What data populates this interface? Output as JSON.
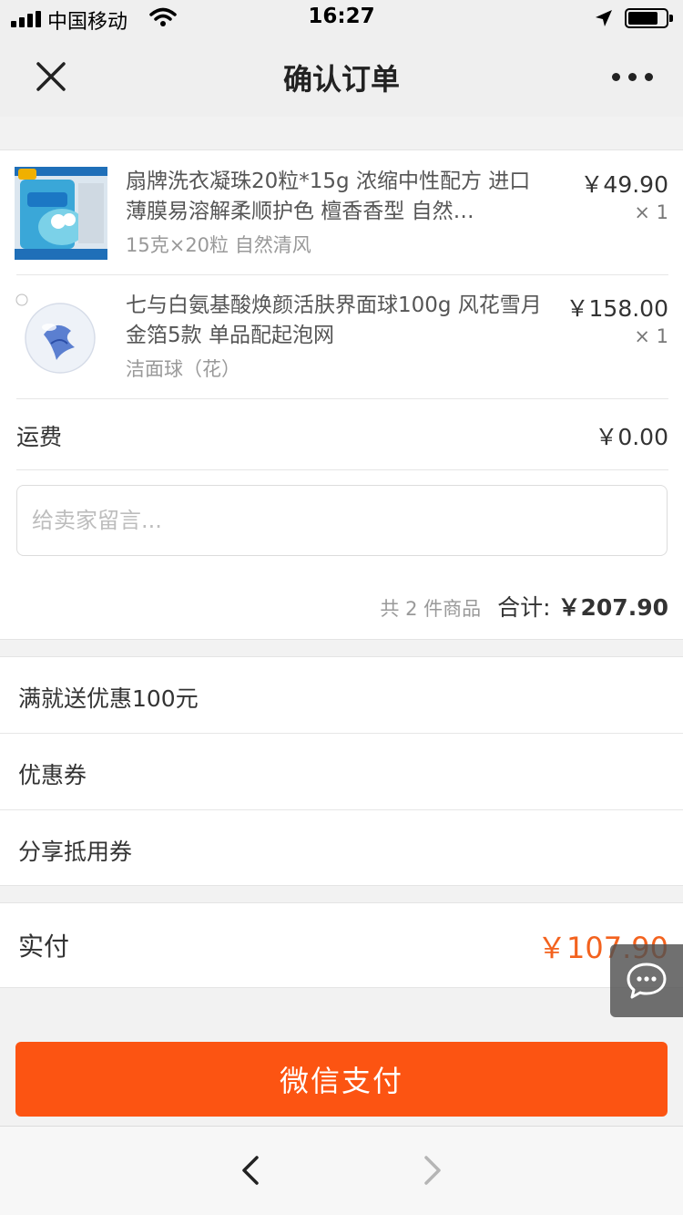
{
  "status_bar": {
    "carrier": "中国移动",
    "time": "16:27"
  },
  "nav": {
    "title": "确认订单",
    "close_icon": "close-icon",
    "more_icon": "more-icon"
  },
  "order": {
    "items": [
      {
        "title": "扇牌洗衣凝珠20粒*15g 浓缩中性配方 进口薄膜易溶解柔顺护色 檀香香型 自然…",
        "spec": "15克×20粒 自然清风",
        "price": "￥49.90",
        "qty": "× 1"
      },
      {
        "title": "七与白氨基酸焕颜活肤界面球100g 风花雪月金箔5款 单品配起泡网",
        "spec": "洁面球（花）",
        "price": "￥158.00",
        "qty": "× 1"
      }
    ],
    "shipping_label": "运费",
    "shipping_value": "￥0.00",
    "remark_placeholder": "给卖家留言...",
    "item_count": "共 2 件商品",
    "total_label": "合计: ",
    "total_value": "￥207.90"
  },
  "promotions": [
    {
      "label": "满就送优惠100元"
    },
    {
      "label": "优惠券"
    },
    {
      "label": "分享抵用券"
    }
  ],
  "payable": {
    "label": "实付",
    "value": "￥107.90"
  },
  "pay_button_label": "微信支付",
  "colors": {
    "accent": "#fc5412",
    "price_highlight": "#f3621e",
    "background": "#f2f2f2"
  }
}
